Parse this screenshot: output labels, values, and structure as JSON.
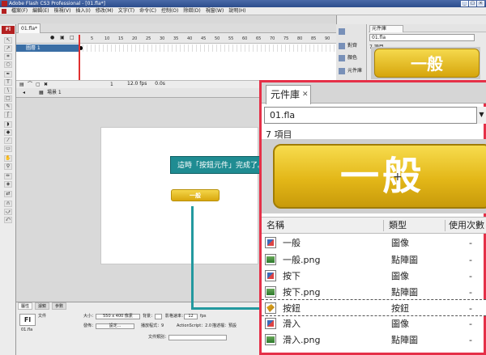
{
  "window": {
    "title": "Adobe Flash CS3 Professional - [01.fla*]"
  },
  "menu": [
    "檔案(F)",
    "編輯(E)",
    "檢視(V)",
    "插入(I)",
    "修改(M)",
    "文字(T)",
    "命令(C)",
    "控制(O)",
    "除錯(D)",
    "視窗(W)",
    "說明(H)"
  ],
  "doc": {
    "tab": "01.fla*",
    "layer": "圖層 1",
    "scene": "場景 1",
    "fps": "12.0 fps",
    "time": "0.0s",
    "frame": "1"
  },
  "timeline": {
    "frame_numbers": [
      "5",
      "10",
      "15",
      "20",
      "25",
      "30",
      "35",
      "40",
      "45",
      "50",
      "55",
      "60",
      "65",
      "70",
      "75",
      "80",
      "85",
      "90"
    ]
  },
  "stage_button": {
    "label": "一般"
  },
  "tooltip": {
    "text": "這時「按鈕元件」完成了。"
  },
  "side_icons": [
    {
      "label": "對齊"
    },
    {
      "label": "顏色"
    },
    {
      "label": "元件庫"
    }
  ],
  "mini_library": {
    "tab": "元件庫",
    "file": "01.fla",
    "count": "7 項目",
    "preview": "一般"
  },
  "props": {
    "tabs": [
      "屬性",
      "濾鏡",
      "參數"
    ],
    "doc_type": "文件",
    "doc_name": "01.fla",
    "size_label": "大小：",
    "size_value": "550 x 400 像素",
    "bg_label": "背景：",
    "rate_label": "影格速率：",
    "rate_value": "12",
    "fps_unit": "fps",
    "publish_label": "發佈：",
    "settings_btn": "設定...",
    "player_label": "播放程式：9",
    "as_label": "ActionScript：2.0",
    "profile_label": "描述檔：預設",
    "class_label": "文件類別："
  },
  "library": {
    "tab": "元件庫",
    "file": "01.fla",
    "count": "7 項目",
    "preview_label": "一般",
    "columns": {
      "name": "名稱",
      "type": "類型",
      "use": "使用次數"
    },
    "items": [
      {
        "name": "一般",
        "type": "圖像",
        "use": "-",
        "icon": "graphic-icon"
      },
      {
        "name": "一般.png",
        "type": "點陣圖",
        "use": "-",
        "icon": "bitmap-icon"
      },
      {
        "name": "按下",
        "type": "圖像",
        "use": "-",
        "icon": "graphic-icon"
      },
      {
        "name": "按下.png",
        "type": "點陣圖",
        "use": "-",
        "icon": "bitmap-icon"
      },
      {
        "name": "按鈕",
        "type": "按鈕",
        "use": "-",
        "icon": "button-symbol-icon"
      },
      {
        "name": "滑入",
        "type": "圖像",
        "use": "-",
        "icon": "graphic-icon"
      },
      {
        "name": "滑入.png",
        "type": "點陣圖",
        "use": "-",
        "icon": "bitmap-icon"
      }
    ]
  }
}
